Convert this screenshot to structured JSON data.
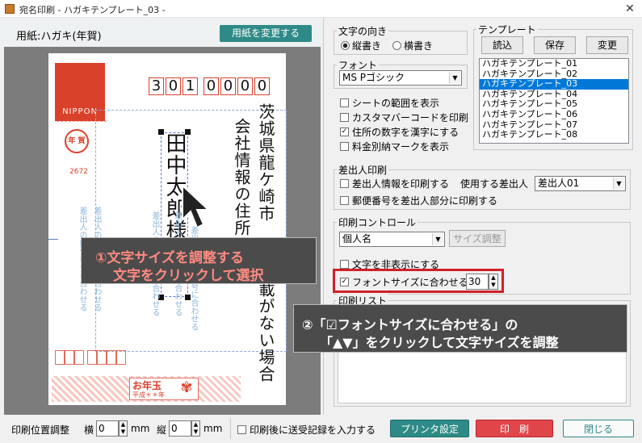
{
  "window": {
    "title": "宛名印刷 - ハガキテンプレート_03 -",
    "close_glyph": "✕"
  },
  "paper": {
    "label": "用紙:ハガキ(年賀)",
    "change_button": "用紙を変更する"
  },
  "card": {
    "stamp_text": "NIPPON",
    "nenga_text": "年 賀",
    "stamp_number": "2672",
    "zip_digits": [
      "3",
      "0",
      "1",
      "0",
      "0",
      "0",
      "0"
    ],
    "address_col1": "茨城県龍ケ崎市",
    "address_col1_b": "載がない場合",
    "address_col2": "会社情報の住所",
    "address_col2_b": "掲",
    "name": "田中太郎様",
    "sender_vertical": "差出人の郵便番号に合わせる",
    "otoshidama_title": "お年玉",
    "otoshidama_sub": "平成＊＊年"
  },
  "callouts": {
    "callout1_line1": "①文字サイズを調整する",
    "callout1_line2": "文字をクリックして選択",
    "callout2_line1": "②「☑フォントサイズに合わせる」の",
    "callout2_line2": "「▲▼」をクリックして文字サイズを調整"
  },
  "orientation": {
    "legend": "文字の向き",
    "vertical": "縦書き",
    "horizontal": "横書き",
    "selected": "vertical"
  },
  "font": {
    "legend": "フォント",
    "value": "MS Pゴシック"
  },
  "options": [
    {
      "label": "シートの範囲を表示",
      "checked": false
    },
    {
      "label": "カスタマバーコードを印刷",
      "checked": false
    },
    {
      "label": "住所の数字を漢字にする",
      "checked": true
    },
    {
      "label": "料金別納マークを表示",
      "checked": false
    }
  ],
  "template": {
    "legend": "テンプレート",
    "buttons": [
      "読込",
      "保存",
      "変更"
    ],
    "items": [
      "ハガキテンプレート_01",
      "ハガキテンプレート_02",
      "ハガキテンプレート_03",
      "ハガキテンプレート_04",
      "ハガキテンプレート_05",
      "ハガキテンプレート_06",
      "ハガキテンプレート_07",
      "ハガキテンプレート_08"
    ],
    "selected_index": 2
  },
  "sender": {
    "legend": "差出人印刷",
    "print_sender": "差出人情報を印刷する",
    "use_sender_label": "使用する差出人",
    "use_sender_value": "差出人01",
    "print_postal": "郵便番号を差出人部分に印刷する"
  },
  "print_control": {
    "legend": "印刷コントロール",
    "field_value": "個人名",
    "size_adjust_button": "サイズ調整",
    "hide_text": "文字を非表示にする",
    "fit_font": "フォントサイズに合わせる",
    "fit_font_checked": true,
    "font_size": "30"
  },
  "print_list": {
    "legend": "印刷リスト"
  },
  "bottom": {
    "position_label": "印刷位置調整",
    "horizontal_label": "横",
    "horizontal_value": "0",
    "vertical_label": "縦",
    "vertical_value": "0",
    "unit": "mm",
    "record_label": "印刷後に送受記録を入力する",
    "printer_button": "プリンタ設定",
    "print_button": "印　刷",
    "close_button": "閉じる"
  },
  "colors": {
    "accent_teal": "#2e8a86",
    "print_red": "#e0454a",
    "highlight_red": "#d0202a",
    "selection_blue": "#0078d7",
    "stamp_red": "#d9412b"
  }
}
